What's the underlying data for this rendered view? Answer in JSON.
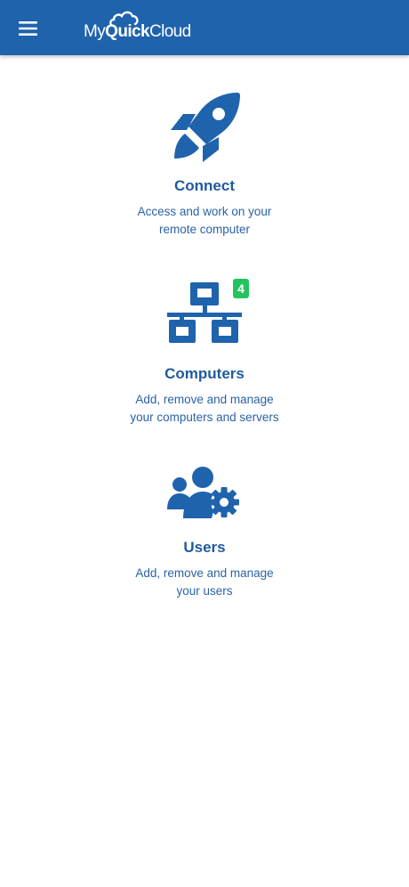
{
  "header": {
    "menu_icon": "hamburger-menu-icon",
    "logo": {
      "part1": "My",
      "part2": "Quick",
      "part3": "Cloud"
    },
    "background_color": "#1f63ad"
  },
  "cards": [
    {
      "icon": "rocket-icon",
      "title": "Connect",
      "description_line1": "Access and work on your",
      "description_line2": "remote computer"
    },
    {
      "icon": "network-icon",
      "title": "Computers",
      "description_line1": "Add, remove and manage",
      "description_line2": "your computers and servers",
      "badge": "4"
    },
    {
      "icon": "users-settings-icon",
      "title": "Users",
      "description_line1": "Add, remove and manage",
      "description_line2": "your users"
    }
  ],
  "colors": {
    "accent": "#1f63ad",
    "badge": "#21c45e",
    "title_text": "#1f5a9e"
  }
}
